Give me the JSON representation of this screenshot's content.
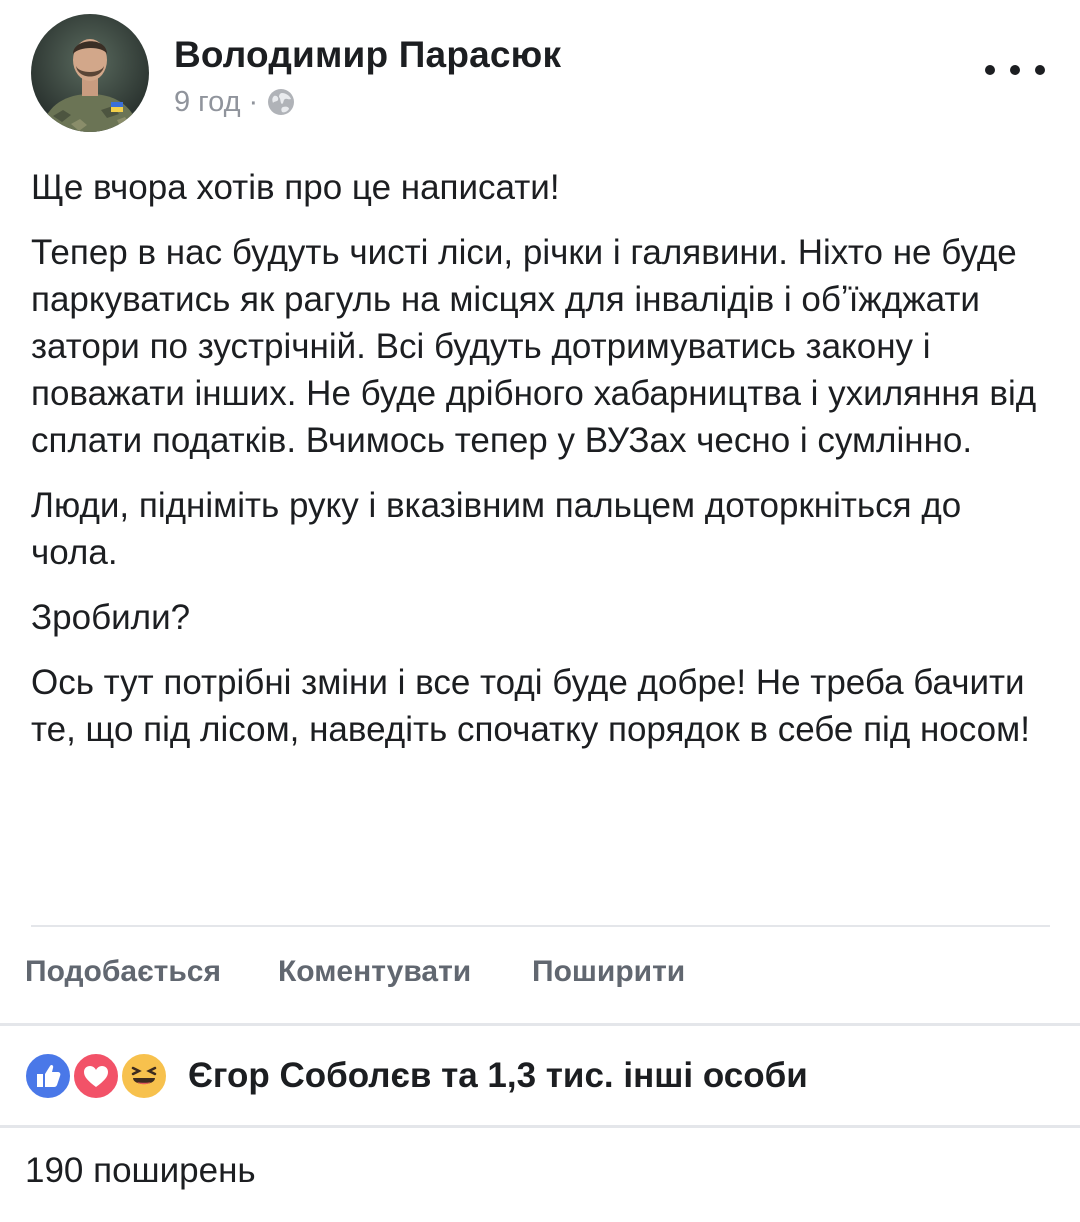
{
  "post": {
    "author": "Володимир Парасюк",
    "time": "9 год",
    "separator": "·",
    "privacy_icon": "globe-icon",
    "more_icon": "more-horizontal-icon",
    "paragraphs": [
      "Ще вчора хотів про це написати!",
      "Тепер в нас будуть чисті ліси, річки і галявини. Ніхто не буде паркуватись як рагуль на місцях для інвалідів і обʼїжджати затори по зустрічній. Всі будуть дотримуватись закону і поважати інших. Не буде дрібного хабарництва і ухиляння від сплати податків. Вчимось тепер у ВУЗах чесно і сумлінно.",
      "Люди, підніміть руку і вказівним пальцем доторкніться до чола.",
      "Зробили?",
      "Ось тут потрібні зміни і все тоді буде добре! Не треба бачити те, що під лісом, наведіть спочатку порядок в себе під носом!"
    ]
  },
  "actions": {
    "like": "Подобається",
    "comment": "Коментувати",
    "share": "Поширити"
  },
  "reactions": {
    "icons": [
      "like-reaction-icon",
      "love-reaction-icon",
      "haha-reaction-icon"
    ],
    "summary": "Єгор Соболєв та 1,3 тис. інші особи"
  },
  "shares": {
    "text": "190 поширень"
  },
  "colors": {
    "text": "#1c1e21",
    "meta": "#90949c",
    "action": "#616770",
    "divider": "#e4e6ea",
    "like_blue": "#4a78e8",
    "love_red": "#f25268",
    "haha_yellow": "#f7c14d"
  }
}
